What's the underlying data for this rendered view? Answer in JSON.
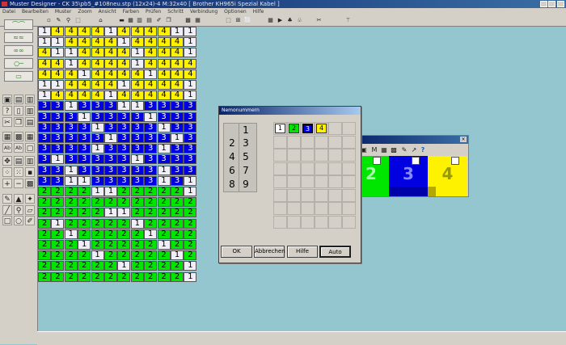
{
  "window": {
    "title": "Muster Designer - CK 35\\pb5_#108neu.stp (12x24)-4  M:32x40  [ Brother KH965i Spezial Kabel ]"
  },
  "menu": [
    "Datei",
    "Bearbeiten",
    "Muster",
    "Zoom",
    "Ansicht",
    "Farben",
    "Prüfen",
    "Schritt",
    "Verbindung",
    "Optionen",
    "Hilfe"
  ],
  "pattern": {
    "rows": [
      "144441444411",
      "114444144441",
      "411444414441",
      "441444414444",
      "444144441444",
      "114444144441",
      "144441444441",
      "331333113333",
      "333133331333",
      "333313333133",
      "333331333313",
      "333313333133",
      "313333313333",
      "331333333133",
      "331133333131",
      "222211222221",
      "222222222222",
      "222221122222",
      "212222212222",
      "221222221222",
      "222122222122",
      "222212222212",
      "222222122221",
      "222222222221"
    ]
  },
  "color_window": {
    "swatches": [
      {
        "id": "2",
        "color": "#00e600",
        "text_color": "#aaffaa"
      },
      {
        "id": "3",
        "color": "#0000e0",
        "text_color": "#8888ff"
      },
      {
        "id": "4",
        "color": "#fff200",
        "text_color": "#999900"
      }
    ]
  },
  "dialog": {
    "title": "Nemonummern",
    "numbers": [
      "1",
      "2",
      "3",
      "4",
      "5",
      "6",
      "7",
      "8",
      "9"
    ],
    "slots": [
      "1",
      "2",
      "3",
      "4"
    ],
    "buttons": {
      "ok": "OK",
      "cancel": "Abbrechen",
      "help": "Hilfe",
      "auto": "Auto"
    }
  },
  "colors": {
    "1": "#f0eef6",
    "2": "#00e600",
    "3": "#0000e0",
    "4": "#fff200"
  }
}
